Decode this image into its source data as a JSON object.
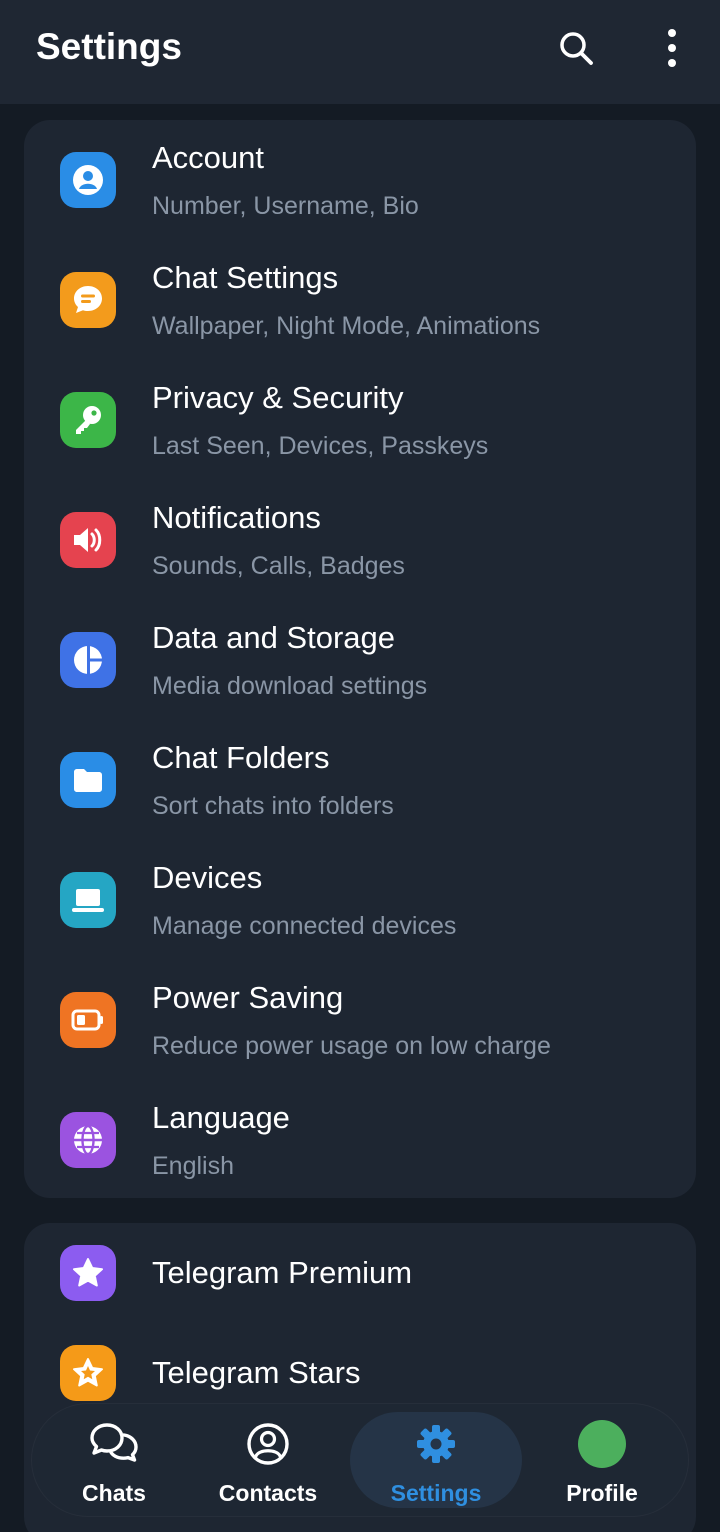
{
  "header": {
    "title": "Settings",
    "search_icon": "search-icon",
    "more_icon": "more-vertical-icon"
  },
  "colors": {
    "background": "#141b24",
    "card": "#1e2632",
    "subtitle": "#8a96a6",
    "accent": "#2f8fe0"
  },
  "settings_items": [
    {
      "title": "Account",
      "subtitle": "Number, Username, Bio",
      "icon": "account-icon",
      "color": "#2a8de6"
    },
    {
      "title": "Chat Settings",
      "subtitle": "Wallpaper, Night Mode, Animations",
      "icon": "chat-settings-icon",
      "color": "#f39b1c"
    },
    {
      "title": "Privacy & Security",
      "subtitle": "Last Seen, Devices, Passkeys",
      "icon": "key-icon",
      "color": "#3cb648"
    },
    {
      "title": "Notifications",
      "subtitle": "Sounds, Calls, Badges",
      "icon": "speaker-icon",
      "color": "#e5434f"
    },
    {
      "title": "Data and Storage",
      "subtitle": "Media download settings",
      "icon": "pie-chart-icon",
      "color": "#3f72e6"
    },
    {
      "title": "Chat Folders",
      "subtitle": "Sort chats into folders",
      "icon": "folder-icon",
      "color": "#2a8de6"
    },
    {
      "title": "Devices",
      "subtitle": "Manage connected devices",
      "icon": "laptop-icon",
      "color": "#25a6c4"
    },
    {
      "title": "Power Saving",
      "subtitle": "Reduce power usage on low charge",
      "icon": "battery-icon",
      "color": "#ef7423"
    },
    {
      "title": "Language",
      "subtitle": "English",
      "icon": "globe-icon",
      "color": "#9b53e0"
    }
  ],
  "premium_items": [
    {
      "title": "Telegram Premium",
      "icon": "premium-star-icon",
      "color": "#8c5cf0"
    },
    {
      "title": "Telegram Stars",
      "icon": "stars-icon",
      "color": "#f59a18"
    }
  ],
  "bottom_nav": {
    "items": [
      {
        "label": "Chats",
        "icon": "chats-icon"
      },
      {
        "label": "Contacts",
        "icon": "contacts-icon"
      },
      {
        "label": "Settings",
        "icon": "settings-gear-icon",
        "active": true
      },
      {
        "label": "Profile",
        "icon": "profile-avatar"
      }
    ]
  }
}
